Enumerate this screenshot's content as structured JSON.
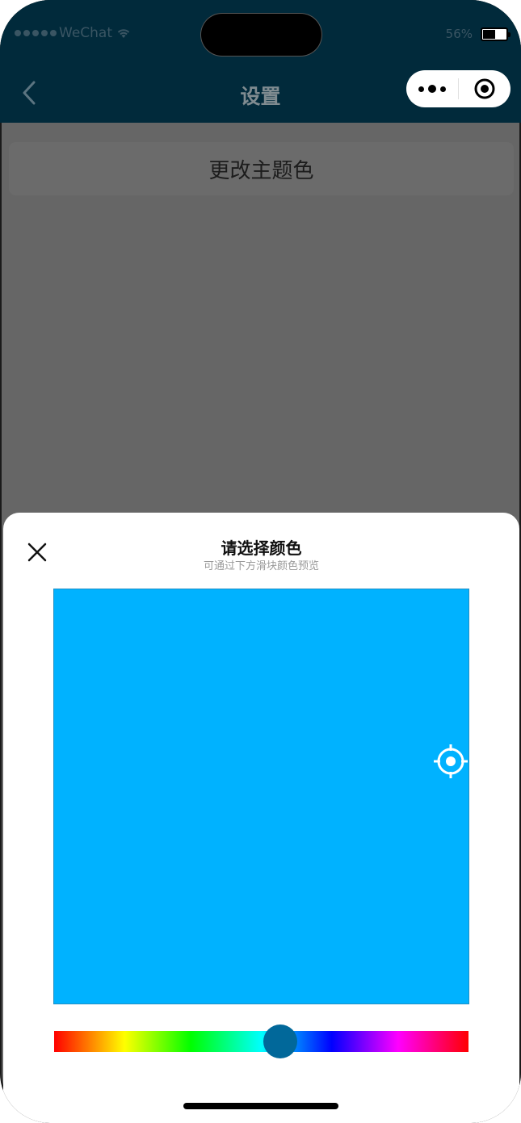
{
  "status": {
    "carrier": "WeChat",
    "battery": "56%"
  },
  "nav": {
    "title": "设置"
  },
  "page": {
    "change_theme_label": "更改主题色"
  },
  "sheet": {
    "title": "请选择颜色",
    "subtitle": "可通过下方滑块颜色预览",
    "selected_color": "#00B2FF",
    "hue_thumb_color": "#01689A",
    "hue_position": 0.545
  },
  "colors": {
    "nav_bg": "#012A3B",
    "overlay": "#666666",
    "sheet_bg": "#FFFFFF"
  },
  "icons": [
    "back-icon",
    "more-icon",
    "record-icon",
    "close-icon",
    "crosshair-icon",
    "wifi-icon",
    "battery-icon"
  ]
}
